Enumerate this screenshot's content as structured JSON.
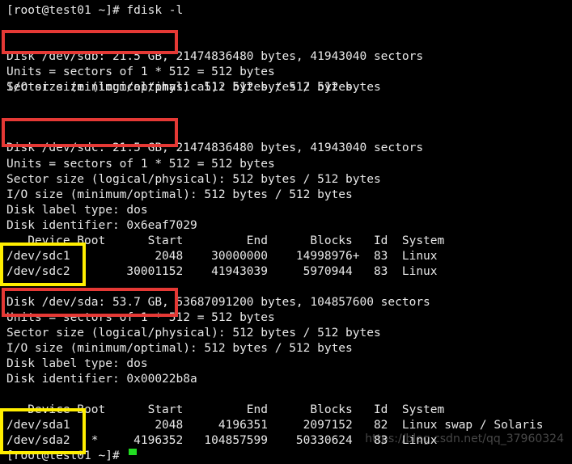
{
  "terminal": {
    "lines": [
      "[root@test01 ~]# fdisk -l",
      "",
      "Disk /dev/sdb: 21.5 GB, 21474836480 bytes, 41943040 sectors",
      "Units = sectors of 1 * 512 = 512 bytes",
      "Sector size (logical/physical): 512 bytes / 512 bytes",
      "I/O size (minimum/optimal): 512 bytes / 512 bytes",
      "",
      "",
      "Disk /dev/sdc: 21.5 GB, 21474836480 bytes, 41943040 sectors",
      "Units = sectors of 1 * 512 = 512 bytes",
      "Sector size (logical/physical): 512 bytes / 512 bytes",
      "I/O size (minimum/optimal): 512 bytes / 512 bytes",
      "Disk label type: dos",
      "Disk identifier: 0x6eaf7029",
      "",
      "   Device Boot      Start         End      Blocks   Id  System",
      "/dev/sdc1            2048    30000000    14998976+  83  Linux",
      "/dev/sdc2        30001152    41943039     5970944   83  Linux",
      "",
      "Disk /dev/sda: 53.7 GB, 53687091200 bytes, 104857600 sectors",
      "Units = sectors of 1 * 512 = 512 bytes",
      "Sector size (logical/physical): 512 bytes / 512 bytes",
      "I/O size (minimum/optimal): 512 bytes / 512 bytes",
      "Disk label type: dos",
      "Disk identifier: 0x00022b8a",
      "",
      "   Device Boot      Start         End      Blocks   Id  System",
      "/dev/sda1            2048     4196351     2097152   82  Linux swap / Solaris",
      "/dev/sda2   *     4196352   104857599    50330624   83  Linux",
      "[root@test01 ~]# "
    ],
    "watermark": "https://blog.csdn.net/qq_37960324"
  }
}
